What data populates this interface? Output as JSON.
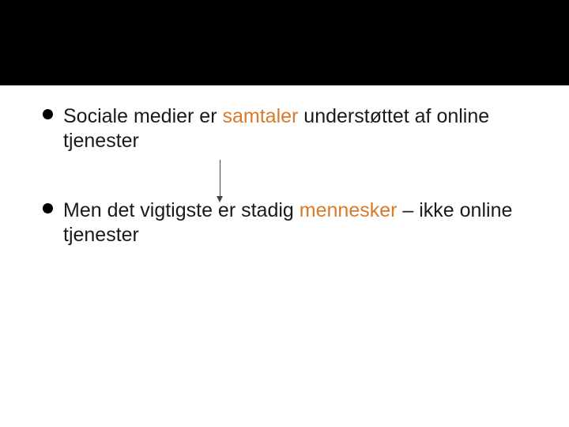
{
  "bullets": [
    {
      "pre": "Sociale medier er ",
      "hl": "samtaler",
      "post": " understøttet af online tjenester"
    },
    {
      "pre": "Men det vigtigste er stadig ",
      "hl": "mennesker",
      "post": " – ikke online tjenester"
    }
  ]
}
